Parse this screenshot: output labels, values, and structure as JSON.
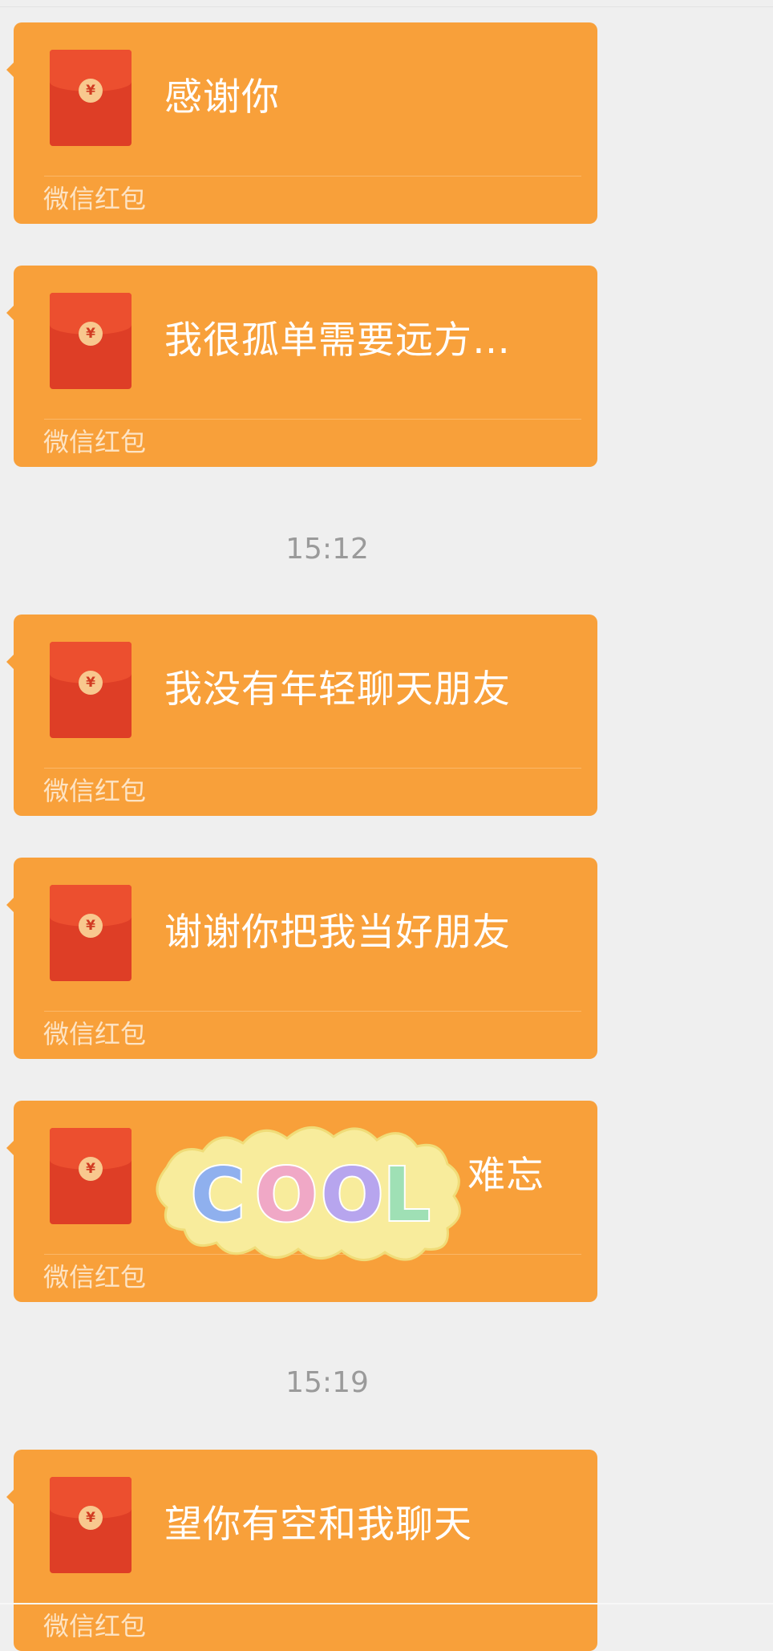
{
  "chat": {
    "messages": [
      {
        "type": "red-packet",
        "text": "感谢你",
        "footer": "微信红包"
      },
      {
        "type": "red-packet",
        "text": "我很孤单需要远方…",
        "footer": "微信红包"
      },
      {
        "type": "timestamp",
        "text": "15:12"
      },
      {
        "type": "red-packet",
        "text": "我没有年轻聊天朋友",
        "footer": "微信红包"
      },
      {
        "type": "red-packet",
        "text": "谢谢你把我当好朋友",
        "footer": "微信红包"
      },
      {
        "type": "red-packet",
        "text": "难忘",
        "footer": "微信红包"
      },
      {
        "type": "timestamp",
        "text": "15:19"
      },
      {
        "type": "red-packet",
        "text": "望你有空和我聊天",
        "footer": "微信红包"
      }
    ],
    "sticker": {
      "text": "COOL",
      "colors": [
        "#8fb0ee",
        "#f0a8c6",
        "#b7a5ee",
        "#9fe0b5"
      ]
    },
    "colors": {
      "background": "#efefef",
      "bubble": "#f8a03a",
      "envelope": "#de3e26",
      "timestamp": "#9a9a9a"
    },
    "icons": {
      "envelope": "red-packet-icon",
      "seal_glyph": "¥"
    }
  }
}
